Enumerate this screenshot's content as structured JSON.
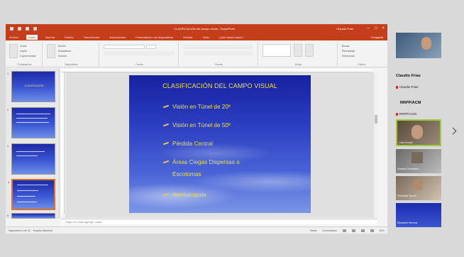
{
  "app": {
    "window_title": "CLASIFICACION del campo visual - PowerPoint",
    "user": "Claudio Frias",
    "share_label": "Compartir"
  },
  "ribbon": {
    "tabs": [
      "Archivo",
      "Inicio",
      "Insertar",
      "Diseño",
      "Transiciones",
      "Animaciones",
      "Presentación con diapositivas",
      "Revisar",
      "Vista",
      "¿Qué desea hacer?"
    ],
    "active_tab": "Inicio",
    "groups": [
      "Portapapeles",
      "Diapositivas",
      "Fuente",
      "Párrafo",
      "Dibujo",
      "Edición"
    ],
    "clipboard_items": [
      "Cortar",
      "Copiar",
      "Copiar formato"
    ],
    "slide_items": [
      "Nueva diapositiva",
      "Diseño",
      "Restablecer",
      "Sección"
    ],
    "editing_items": [
      "Buscar",
      "Reemplazar",
      "Seleccionar"
    ]
  },
  "thumbnails": [
    {
      "number": "1",
      "title": "CLASIFICACIÓN"
    },
    {
      "number": "2",
      "title": ""
    },
    {
      "number": "3",
      "title": ""
    },
    {
      "number": "4",
      "title": "",
      "active": true
    },
    {
      "number": "5",
      "title": ""
    }
  ],
  "slide": {
    "title": "CLASIFICACIÓN DEL CAMPO VISUAL",
    "bullets": [
      "Visión en Túnel de 20º",
      "Visión en Túnel de 50º",
      "Pérdida Central",
      "Áreas Ciegas Dispersas o",
      "Hemianopsia"
    ],
    "bullet_continuation": "Escotomas"
  },
  "notes_placeholder": "Haga clic para agregar notas",
  "status": {
    "slide_counter": "Diapositiva 4 de 20",
    "language": "Español (México)",
    "notes_label": "Notas",
    "comments_label": "Comentarios",
    "zoom": "62%"
  },
  "participants": [
    {
      "name": "Claudio Frias",
      "muted": false,
      "big": true
    },
    {
      "name": "Claudio Frias",
      "muted": true
    },
    {
      "name": "RRPP/ACM",
      "big": true
    },
    {
      "name": "RRPP/ACM",
      "muted": true
    },
    {
      "name": "Lidia Lerasa",
      "muted": false
    },
    {
      "name": "Horacio Fernandez"
    },
    {
      "name": "Fernanda Tacchi"
    },
    {
      "name": "Elizabeth Herrera"
    }
  ],
  "colors": {
    "title_bar": "#c43e1c",
    "slide_text": "#f1e04a",
    "slide_bg": "#2b3dc0",
    "active_thumb_border": "#e07020",
    "active_participant_border": "#9ccc3a"
  }
}
